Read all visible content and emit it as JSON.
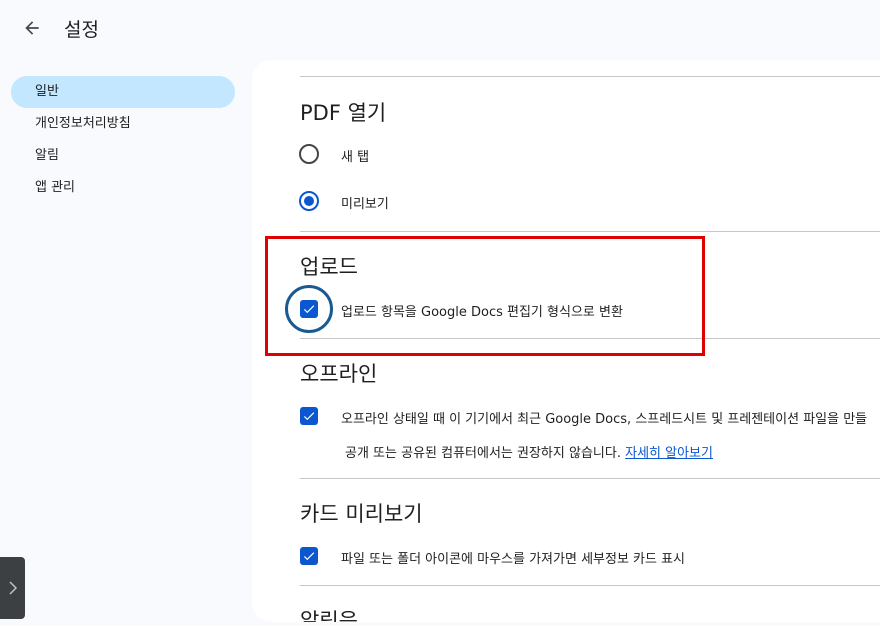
{
  "header": {
    "back_icon": "arrow-left-icon",
    "title": "설정"
  },
  "sidebar": {
    "items": [
      {
        "label": "일반",
        "active": true
      },
      {
        "label": "개인정보처리방침",
        "active": false
      },
      {
        "label": "알림",
        "active": false
      },
      {
        "label": "앱 관리",
        "active": false
      }
    ]
  },
  "sections": {
    "pdf": {
      "title": "PDF 열기",
      "options": [
        {
          "label": "새 탭",
          "checked": false
        },
        {
          "label": "미리보기",
          "checked": true
        }
      ]
    },
    "upload": {
      "title": "업로드",
      "convert_label": "업로드 항목을 Google Docs 편집기 형식으로 변환",
      "checked": true
    },
    "offline": {
      "title": "오프라인",
      "label_line1": "오프라인 상태일 때 이 기기에서 최근 Google Docs, 스프레드시트 및 프레젠테이션 파일을 만들",
      "label_line2": "공개 또는 공유된 컴퓨터에서는 권장하지 않습니다.",
      "link": "자세히 알아보기",
      "checked": true
    },
    "card_preview": {
      "title": "카드 미리보기",
      "label": "파일 또는 폴더 아이콘에 마우스를 가져가면 세부정보 카드 표시",
      "checked": true
    },
    "notifications": {
      "title": "알림음"
    }
  },
  "colors": {
    "accent": "#0b57d0",
    "selected_nav": "#c2e7ff",
    "annotation_red": "#e00000",
    "annotation_circle": "#1a5a90"
  }
}
